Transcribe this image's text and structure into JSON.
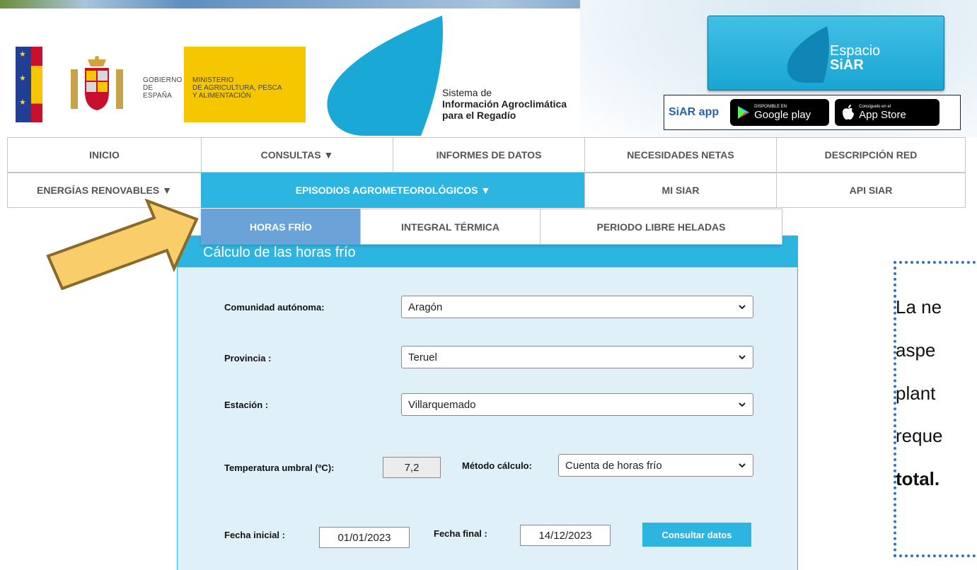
{
  "header": {
    "gov_name": "GOBIERNO\nDE ESPAÑA",
    "ministry_name": "MINISTERIO\nDE AGRICULTURA, PESCA\nY ALIMENTACIÓN",
    "siar_logo_text": "SiAR",
    "siar_tagline_1": "Sistema de",
    "siar_tagline_2": "Información Agroclimática",
    "siar_tagline_3": "para el Regadío",
    "espacio_line_1": "Espacio",
    "espacio_line_2": "SiAR",
    "app_label": "SiAR app",
    "google_small": "DISPONIBLE EN",
    "google_big": "Google play",
    "apple_small": "Consíguelo en el",
    "apple_big": "App Store"
  },
  "nav": {
    "row1": [
      "INICIO",
      "CONSULTAS ▼",
      "INFORMES DE DATOS",
      "NECESIDADES NETAS",
      "DESCRIPCIÓN RED"
    ],
    "row2": [
      "ENERGÍAS RENOVABLES ▼",
      "EPISODIOS AGROMETEOROLÓGICOS ▼",
      "MI SIAR",
      "API SIAR"
    ],
    "active_row2_index": 1
  },
  "subnav": {
    "items": [
      "HORAS FRÍO",
      "INTEGRAL TÉRMICA",
      "PERIODO LIBRE HELADAS"
    ],
    "active_index": 0
  },
  "panel": {
    "title": "Cálculo de las horas frío",
    "comunidad_label": "Comunidad autónoma:",
    "comunidad_value": "Aragón",
    "provincia_label": "Provincia :",
    "provincia_value": "Teruel",
    "estacion_label": "Estación :",
    "estacion_value": "Villarquemado",
    "temp_label": "Temperatura umbral (ºC):",
    "temp_value": "7,2",
    "metodo_label": "Método cálculo:",
    "metodo_value": "Cuenta de horas frío",
    "fecha_inicial_label": "Fecha inicial :",
    "fecha_inicial_value": "01/01/2023",
    "fecha_final_label": "Fecha final :",
    "fecha_final_value": "14/12/2023",
    "submit_label": "Consultar datos"
  },
  "side_note": {
    "lines": [
      "La ne",
      "aspe",
      "plant",
      "reque",
      "total."
    ]
  },
  "colors": {
    "accent": "#2cb5e0",
    "active_tab": "#6aa3d8",
    "arrow_fill": "#f8cd6a",
    "arrow_stroke": "#8a6a2a",
    "note_border": "#2f74c6"
  }
}
